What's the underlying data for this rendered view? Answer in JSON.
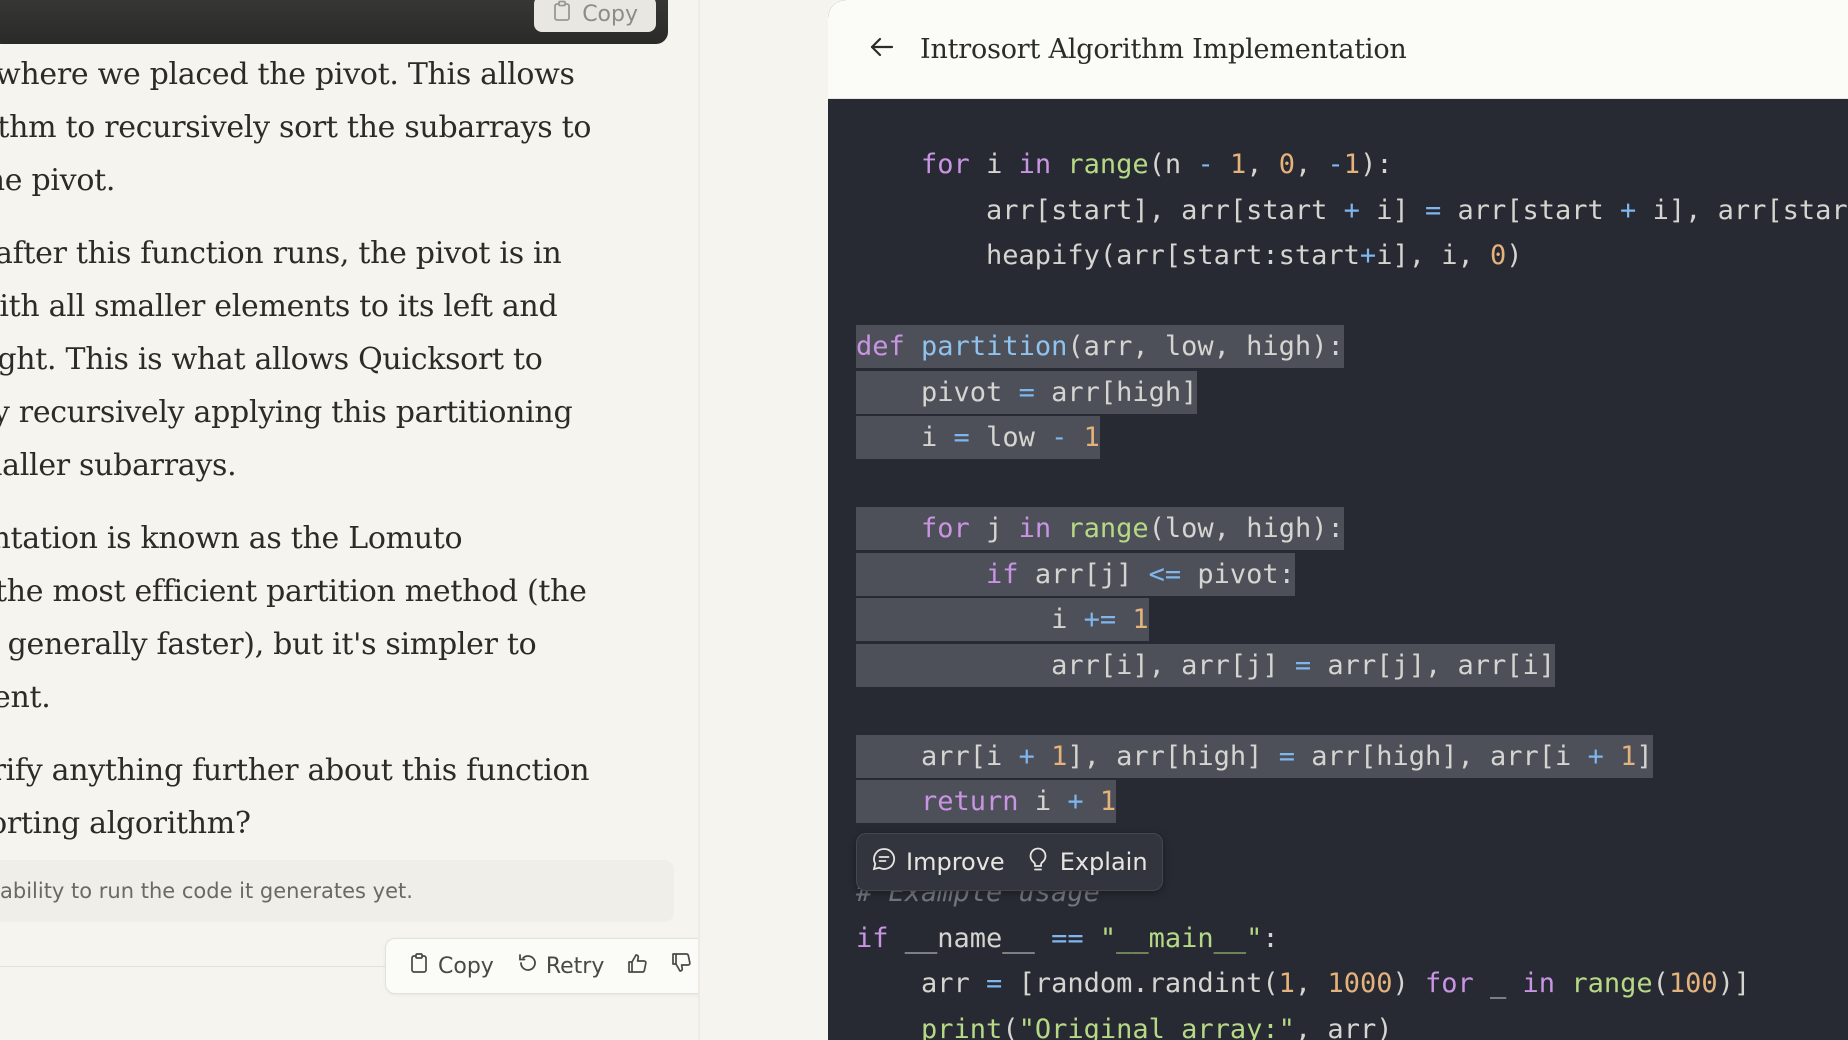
{
  "chat": {
    "prev_block_copy_label": "Copy",
    "paragraphs": [
      [
        "t where we placed the pivot. This allows",
        "rithm to recursively sort the subarrays to",
        " the pivot."
      ],
      [
        "t after this function runs, the pivot is in",
        " with all smaller elements to its left and",
        " right. This is what allows Quicksort to",
        " by recursively applying this partitioning",
        "maller subarrays."
      ],
      [
        "entation is known as the Lomuto",
        "t the most efficient partition method (the",
        " is generally faster), but it's simpler to",
        "nent."
      ],
      [
        "arify anything further about this function",
        "sorting algorithm?"
      ]
    ],
    "disclaimer": "ability to run the code it generates yet.",
    "actions": {
      "copy_label": "Copy",
      "retry_label": "Retry"
    }
  },
  "artifact": {
    "title": "Introsort Algorithm Implementation",
    "toolbar": {
      "improve_label": "Improve",
      "explain_label": "Explain"
    },
    "code_lines": [
      "    for i in range(n - 1, 0, -1):",
      "        arr[start], arr[start + i] = arr[start + i], arr[start",
      "        heapify(arr[start:start+i], i, 0)",
      "",
      "def partition(arr, low, high):",
      "    pivot = arr[high]",
      "    i = low - 1",
      "",
      "    for j in range(low, high):",
      "        if arr[j] <= pivot:",
      "            i += 1",
      "            arr[i], arr[j] = arr[j], arr[i]",
      "",
      "    arr[i + 1], arr[high] = arr[high], arr[i + 1]",
      "    return i + 1",
      "",
      "# Example usage",
      "if __name__ == \"__main__\":",
      "    arr = [random.randint(1, 1000) for _ in range(100)]",
      "    print(\"Original array:\", arr)"
    ],
    "highlighted_lines": [
      4,
      5,
      6,
      8,
      9,
      10,
      11,
      13,
      14
    ]
  },
  "colors": {
    "code_background": "#282a33",
    "selection": "#4e5059",
    "keyword": "#c994e3",
    "function": "#8fc3ee",
    "builtin": "#b6d985",
    "number": "#e4b27a",
    "operator": "#7fb6ee",
    "comment": "#73757d"
  },
  "icons": [
    "clipboard-icon",
    "retry-icon",
    "thumbs-up-icon",
    "thumbs-down-icon",
    "arrow-left-icon",
    "chat-bubble-icon",
    "lightbulb-icon"
  ]
}
